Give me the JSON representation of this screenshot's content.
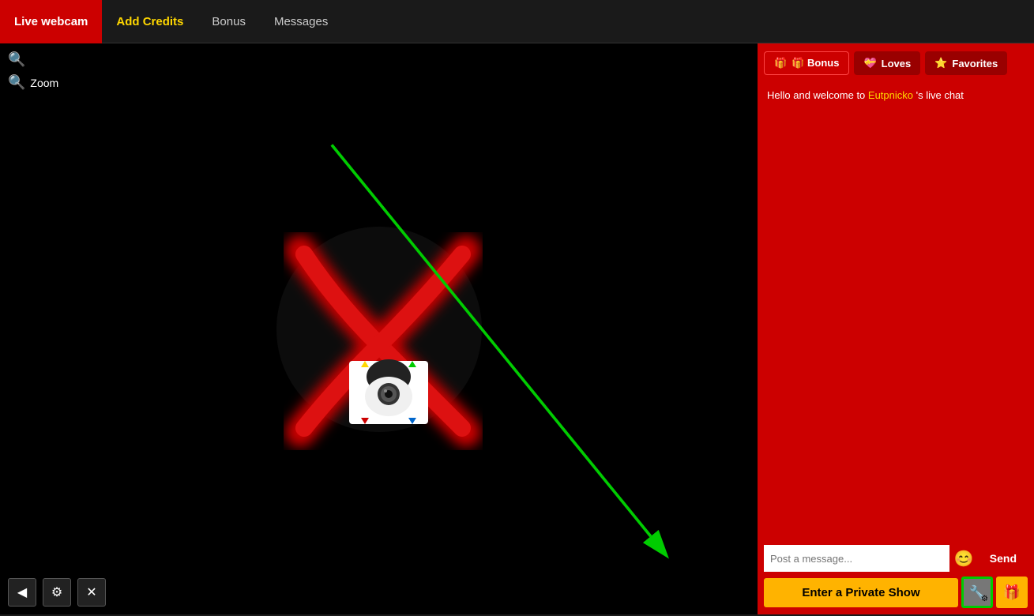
{
  "nav": {
    "items": [
      {
        "id": "live-webcam",
        "label": "Live webcam",
        "active": true
      },
      {
        "id": "add-credits",
        "label": "Add Credits",
        "yellow": true
      },
      {
        "id": "bonus",
        "label": "Bonus"
      },
      {
        "id": "messages",
        "label": "Messages"
      }
    ]
  },
  "video": {
    "zoom_label": "Zoom",
    "search_icon": "🔍"
  },
  "chat": {
    "tabs": [
      {
        "id": "bonus",
        "label": "🎁 Bonus"
      },
      {
        "id": "loves",
        "label": "💝 Loves"
      },
      {
        "id": "favorites",
        "label": "⭐ Favorites"
      }
    ],
    "welcome_prefix": "Hello and welcome to ",
    "username": "Eutpnicko",
    "welcome_suffix": " 's live chat",
    "input_placeholder": "Post a message...",
    "send_label": "Send",
    "private_show_label": "Enter a Private Show",
    "emoji_icon": "😊"
  },
  "bottom_controls": [
    {
      "id": "back",
      "icon": "◀"
    },
    {
      "id": "settings",
      "icon": "⚙"
    },
    {
      "id": "expand",
      "icon": "✕"
    }
  ]
}
